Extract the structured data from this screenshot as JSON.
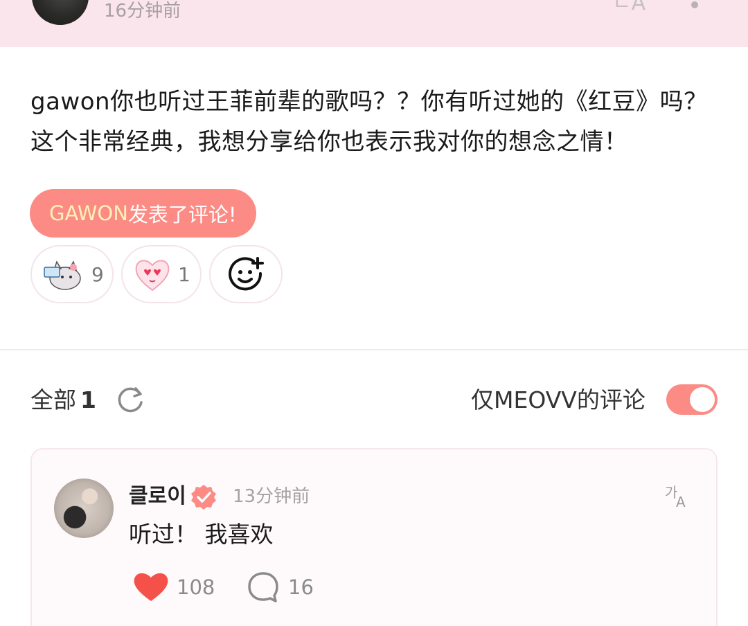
{
  "top": {
    "time": "16分钟前"
  },
  "post": {
    "text_line1": "gawon你也听过王菲前辈的歌吗？？你有听过她的《红豆》吗？",
    "text_line2": "这个非常经典，我想分享给你也表示我对你的想念之情！",
    "pill_name": "GAWON",
    "pill_suffix": "发表了评论!"
  },
  "reactions": [
    {
      "icon": "cat-sticker-icon",
      "count": "9"
    },
    {
      "icon": "heart-face-sticker-icon",
      "count": "1"
    },
    {
      "icon": "add-reaction-icon"
    }
  ],
  "filter": {
    "all_label": "全部",
    "all_count": "1",
    "only_label": "仅MEOVV的评论",
    "toggle_on": true
  },
  "comment": {
    "name": "클로이",
    "time": "13分钟前",
    "text": "听过！ 我喜欢",
    "likes": "108",
    "replies": "16"
  },
  "colors": {
    "accent": "#fb8b84",
    "header_bg": "#fbe5ed",
    "pill_highlight": "#fff2b8"
  }
}
